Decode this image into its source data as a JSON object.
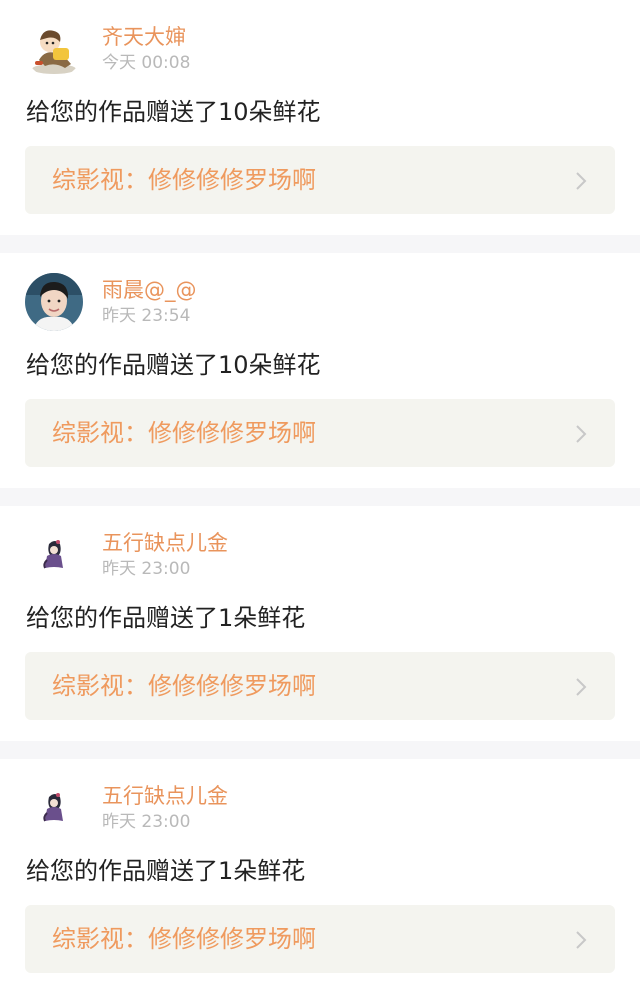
{
  "feed": [
    {
      "user": "齐天大婶",
      "time": "今天 00:08",
      "message": "给您的作品赠送了10朵鲜花",
      "work": "综影视：修修修修罗场啊",
      "avatar_icon": "cartoon-character-avatar"
    },
    {
      "user": "雨晨@_@",
      "time": "昨天 23:54",
      "message": "给您的作品赠送了10朵鲜花",
      "work": "综影视：修修修修罗场啊",
      "avatar_icon": "portrait-photo-avatar"
    },
    {
      "user": "五行缺点儿金",
      "time": "昨天 23:00",
      "message": "给您的作品赠送了1朵鲜花",
      "work": "综影视：修修修修罗场啊",
      "avatar_icon": "small-figure-avatar"
    },
    {
      "user": "五行缺点儿金",
      "time": "昨天 23:00",
      "message": "给您的作品赠送了1朵鲜花",
      "work": "综影视：修修修修罗场啊",
      "avatar_icon": "small-figure-avatar"
    }
  ],
  "colors": {
    "username": "#e9945c",
    "timestamp": "#b9b9b9",
    "message": "#222222",
    "link_text": "#ef9a5e",
    "link_bg": "#f4f4ef",
    "divider": "#f6f6f8"
  }
}
